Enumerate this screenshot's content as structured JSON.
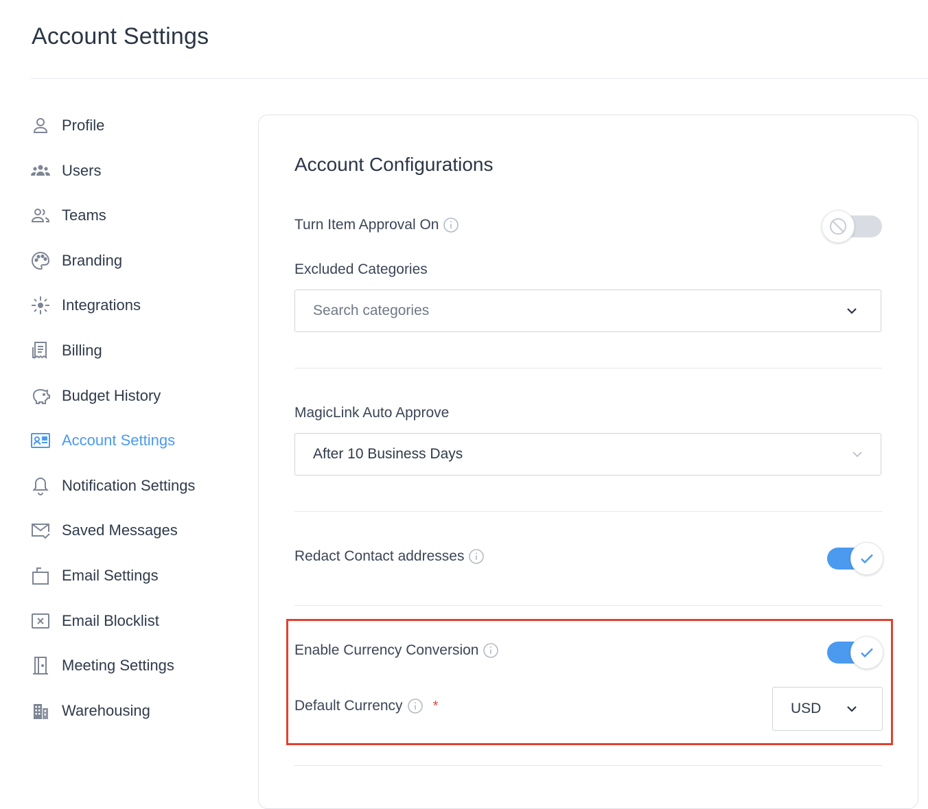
{
  "page": {
    "title": "Account Settings"
  },
  "sidebar": {
    "items": [
      {
        "label": "Profile",
        "icon": "user-icon"
      },
      {
        "label": "Users",
        "icon": "users-icon"
      },
      {
        "label": "Teams",
        "icon": "team-icon"
      },
      {
        "label": "Branding",
        "icon": "palette-icon"
      },
      {
        "label": "Integrations",
        "icon": "integrations-icon"
      },
      {
        "label": "Billing",
        "icon": "receipt-icon"
      },
      {
        "label": "Budget History",
        "icon": "piggy-bank-icon"
      },
      {
        "label": "Account Settings",
        "icon": "account-card-icon",
        "active": true
      },
      {
        "label": "Notification Settings",
        "icon": "bell-icon"
      },
      {
        "label": "Saved Messages",
        "icon": "mail-check-icon"
      },
      {
        "label": "Email Settings",
        "icon": "email-settings-icon"
      },
      {
        "label": "Email Blocklist",
        "icon": "blocked-box-icon"
      },
      {
        "label": "Meeting Settings",
        "icon": "door-icon"
      },
      {
        "label": "Warehousing",
        "icon": "building-icon"
      }
    ]
  },
  "config": {
    "title": "Account Configurations",
    "item_approval": {
      "label": "Turn Item Approval On",
      "enabled": false
    },
    "excluded_categories": {
      "label": "Excluded Categories",
      "placeholder": "Search categories"
    },
    "magiclink": {
      "label": "MagicLink Auto Approve",
      "value": "After 10 Business Days"
    },
    "redact_contact": {
      "label": "Redact Contact addresses",
      "enabled": true
    },
    "currency_conversion": {
      "label": "Enable Currency Conversion",
      "enabled": true
    },
    "default_currency": {
      "label": "Default Currency",
      "required_mark": "*",
      "value": "USD"
    }
  },
  "colors": {
    "accent": "#4a9af0",
    "highlight": "#e0422f",
    "toggle_off": "#d9dde3"
  }
}
